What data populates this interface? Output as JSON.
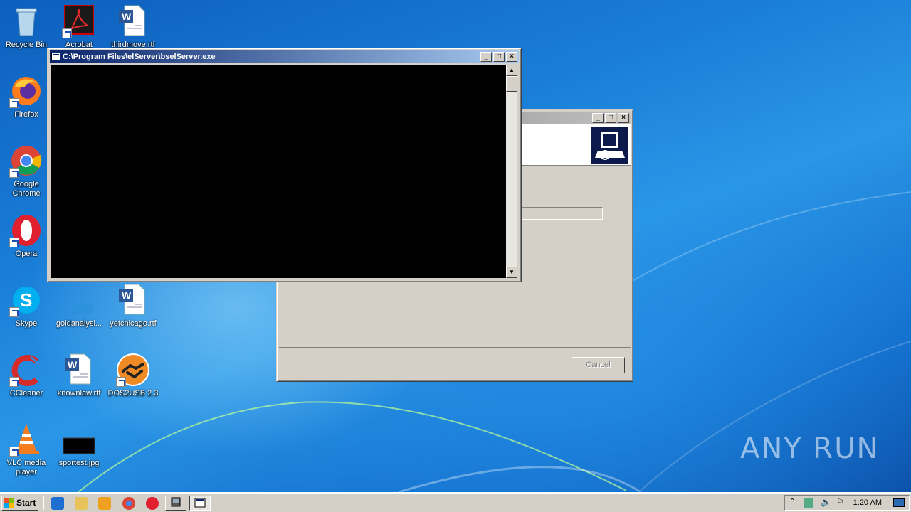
{
  "desktop": {
    "icons": [
      {
        "id": "recycle-bin",
        "label": "Recycle Bin"
      },
      {
        "id": "acrobat",
        "label": "Acrobat"
      },
      {
        "id": "thirdmove",
        "label": "thirdmove.rtf"
      },
      {
        "id": "firefox",
        "label": "Firefox"
      },
      {
        "id": "chrome",
        "label": "Google Chrome"
      },
      {
        "id": "opera",
        "label": "Opera"
      },
      {
        "id": "skype",
        "label": "Skype"
      },
      {
        "id": "goldanalysis",
        "label": "goldanalysi..."
      },
      {
        "id": "yetchicago",
        "label": "yetchicago.rtf"
      },
      {
        "id": "ccleaner",
        "label": "CCleaner"
      },
      {
        "id": "knownlaw",
        "label": "knownlaw.rtf"
      },
      {
        "id": "dos2usb",
        "label": "DOS2USB 2.3"
      },
      {
        "id": "vlc",
        "label": "VLC media player"
      },
      {
        "id": "sportest",
        "label": "sportest.jpg"
      }
    ]
  },
  "console_window": {
    "title": "C:\\Program Files\\elServer\\bselServer.exe"
  },
  "installer_window": {
    "progress": 0.6,
    "cancel_label": "Cancel"
  },
  "taskbar": {
    "start_label": "Start",
    "clock": "1:20 AM"
  },
  "watermark": "ANY RUN",
  "colors": {
    "titlebar_active": "#0a246a",
    "progress_fill": "#0a246a",
    "console_bg": "#000000"
  }
}
